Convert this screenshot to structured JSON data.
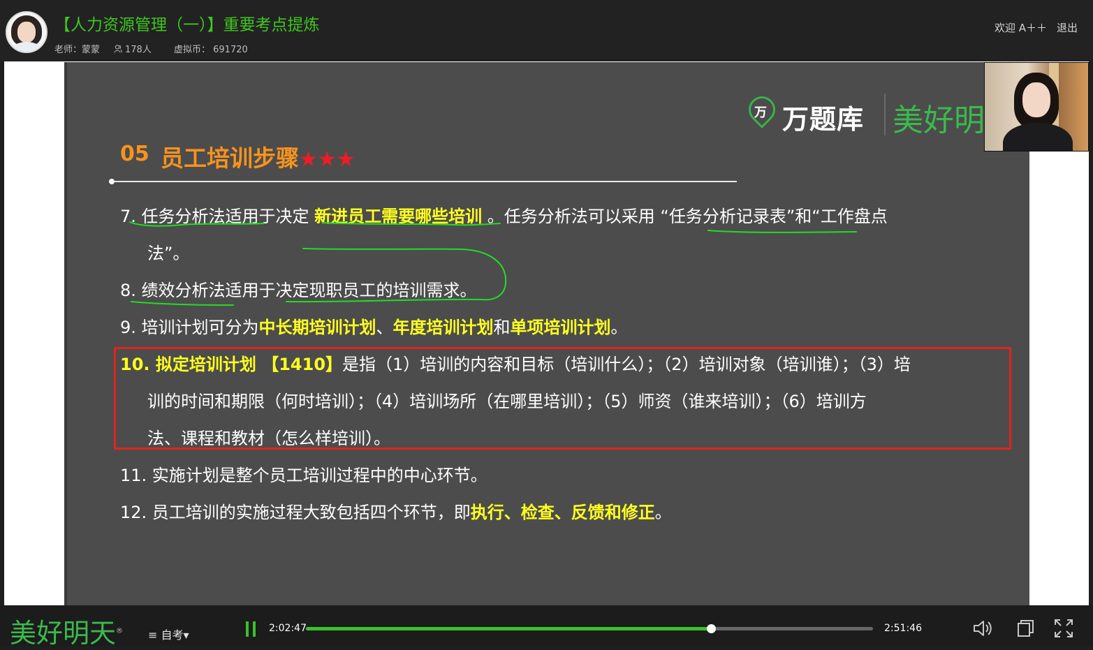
{
  "header": {
    "course_title": "【人力资源管理（一）】重要考点提炼",
    "teacher": "老师：蒙蒙",
    "viewers": "178人",
    "coins": "虚拟币： 691720",
    "welcome": "欢迎 A＋＋",
    "logout": "退出"
  },
  "slide": {
    "brand_icon_text": "万",
    "brand_name": "万题库",
    "brand_name2": "美好明",
    "section_number": "05",
    "section_title": "员工培训步骤",
    "section_stars": "★★★",
    "items": [
      {
        "a": "7.  任务分析法适用于决定 ",
        "b": "新进员工需要哪些培训",
        "c": " 。任务分析法可以采用 “任务分析记录表”和“工作盘点"
      },
      {
        "a": "法”。"
      },
      {
        "a": "8.  绩效分析法适用于决定现职员工的培训需求。"
      },
      {
        "a": "9.  培训计划可分为",
        "b": "中长期培训计划",
        "c": "、",
        "d": "年度培训计划",
        "e": "和",
        "f": "单项培训计划",
        "g": "。"
      },
      {
        "a": "10. 拟定培训计划 【1410】",
        "b": "是指（1）培训的内容和目标（培训什么）；（2）培训对象（培训谁）；（3）培"
      },
      {
        "a": "训的时间和期限（何时培训）；（4）培训场所（在哪里培训）；（5）师资（谁来培训）；（6）培训方"
      },
      {
        "a": "法、课程和教材（怎么样培训）。"
      },
      {
        "a": "11. 实施计划是整个员工培训过程中的中心环节。"
      },
      {
        "a": "12. 员工培训的实施过程大致包括四个环节，即",
        "b": "执行、检查、反馈和修正",
        "c": "。"
      }
    ]
  },
  "player": {
    "logo": "美好明天",
    "logo_mark": "®",
    "category": "≡ 自考▾",
    "current_time": "2:02:47",
    "total_time": "2:51:46",
    "progress": 0.714,
    "accent_color": "#39c229"
  },
  "icons": [
    "pause-icon",
    "volume-icon",
    "picture-in-picture-icon",
    "fullscreen-icon",
    "user-icon"
  ]
}
